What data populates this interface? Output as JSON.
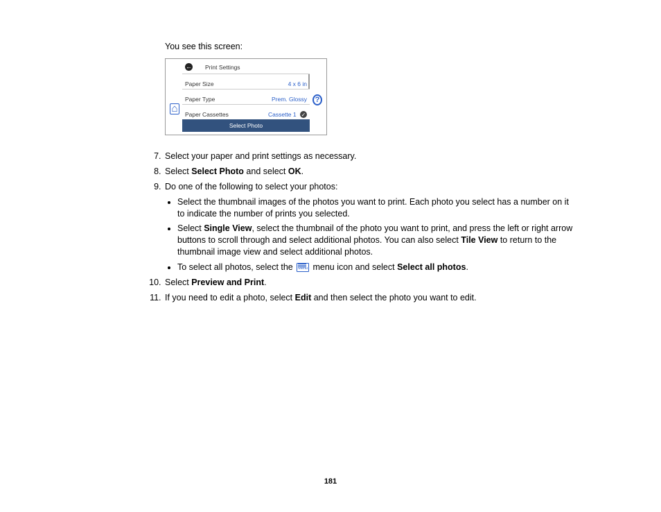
{
  "intro": "You see this screen:",
  "mockup": {
    "title": "Print Settings",
    "rows": [
      {
        "label": "Paper Size",
        "value": "4 x 6 in"
      },
      {
        "label": "Paper Type",
        "value": "Prem. Glossy"
      },
      {
        "label": "Paper Cassettes",
        "value": "Cassette 1"
      }
    ],
    "button": "Select Photo"
  },
  "steps": {
    "s7": "Select your paper and print settings as necessary.",
    "s8_a": "Select ",
    "s8_b": "Select Photo",
    "s8_c": " and select ",
    "s8_d": "OK",
    "s8_e": ".",
    "s9": "Do one of the following to select your photos:",
    "s9_b1": "Select the thumbnail images of the photos you want to print. Each photo you select has a number on it to indicate the number of prints you selected.",
    "s9_b2_a": "Select ",
    "s9_b2_b": "Single View",
    "s9_b2_c": ", select the thumbnail of the photo you want to print, and press the left or right arrow buttons to scroll through and select additional photos. You can also select ",
    "s9_b2_d": "Tile View",
    "s9_b2_e": " to return to the thumbnail image view and select additional photos.",
    "s9_b3_a": "To select all photos, select the ",
    "s9_b3_menu": "Menu",
    "s9_b3_b": " menu icon and select ",
    "s9_b3_c": "Select all photos",
    "s9_b3_d": ".",
    "s10_a": "Select ",
    "s10_b": "Preview and Print",
    "s10_c": ".",
    "s11_a": "If you need to edit a photo, select ",
    "s11_b": "Edit",
    "s11_c": " and then select the photo you want to edit."
  },
  "page_number": "181"
}
